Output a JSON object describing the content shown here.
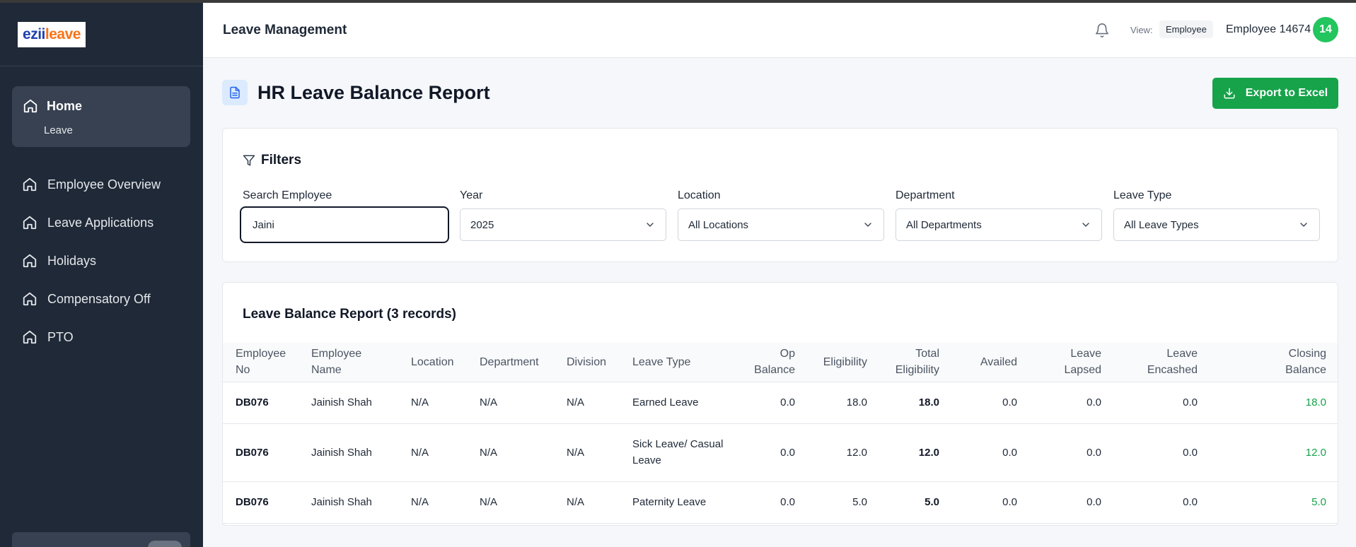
{
  "app": {
    "logo_part1": "ezii",
    "logo_part2": "leave",
    "title": "Leave Management"
  },
  "header": {
    "view_label": "View:",
    "view_value": "Employee",
    "user_name": "Employee 14674",
    "avatar_initials": "14"
  },
  "sidebar": {
    "home_label": "Home",
    "home_sub": "Leave",
    "items": [
      {
        "label": "Employee Overview"
      },
      {
        "label": "Leave Applications"
      },
      {
        "label": "Holidays"
      },
      {
        "label": "Compensatory Off"
      },
      {
        "label": "PTO"
      }
    ]
  },
  "page": {
    "title": "HR Leave Balance Report",
    "export_label": "Export to Excel"
  },
  "filters": {
    "title": "Filters",
    "search_label": "Search Employee",
    "search_value": "Jaini",
    "year_label": "Year",
    "year_value": "2025",
    "location_label": "Location",
    "location_value": "All Locations",
    "department_label": "Department",
    "department_value": "All Departments",
    "leave_type_label": "Leave Type",
    "leave_type_value": "All Leave Types"
  },
  "report": {
    "title": "Leave Balance Report (3 records)",
    "columns": [
      "Employee No",
      "Employee Name",
      "Location",
      "Department",
      "Division",
      "Leave Type",
      "Op Balance",
      "Eligibility",
      "Total Eligibility",
      "Availed",
      "Leave Lapsed",
      "Leave Encashed",
      "Closing Balance"
    ],
    "rows": [
      {
        "emp_no": "DB076",
        "name": "Jainish Shah",
        "location": "N/A",
        "department": "N/A",
        "division": "N/A",
        "leave_type": "Earned Leave",
        "op_balance": "0.0",
        "eligibility": "18.0",
        "total_eligibility": "18.0",
        "availed": "0.0",
        "lapsed": "0.0",
        "encashed": "0.0",
        "closing": "18.0"
      },
      {
        "emp_no": "DB076",
        "name": "Jainish Shah",
        "location": "N/A",
        "department": "N/A",
        "division": "N/A",
        "leave_type": "Sick Leave/ Casual Leave",
        "op_balance": "0.0",
        "eligibility": "12.0",
        "total_eligibility": "12.0",
        "availed": "0.0",
        "lapsed": "0.0",
        "encashed": "0.0",
        "closing": "12.0"
      },
      {
        "emp_no": "DB076",
        "name": "Jainish Shah",
        "location": "N/A",
        "department": "N/A",
        "division": "N/A",
        "leave_type": "Paternity Leave",
        "op_balance": "0.0",
        "eligibility": "5.0",
        "total_eligibility": "5.0",
        "availed": "0.0",
        "lapsed": "0.0",
        "encashed": "0.0",
        "closing": "5.0"
      }
    ]
  },
  "colors": {
    "sidebar_bg": "#1f2937",
    "accent_green": "#16a34a",
    "avatar_bg": "#22c55e"
  }
}
